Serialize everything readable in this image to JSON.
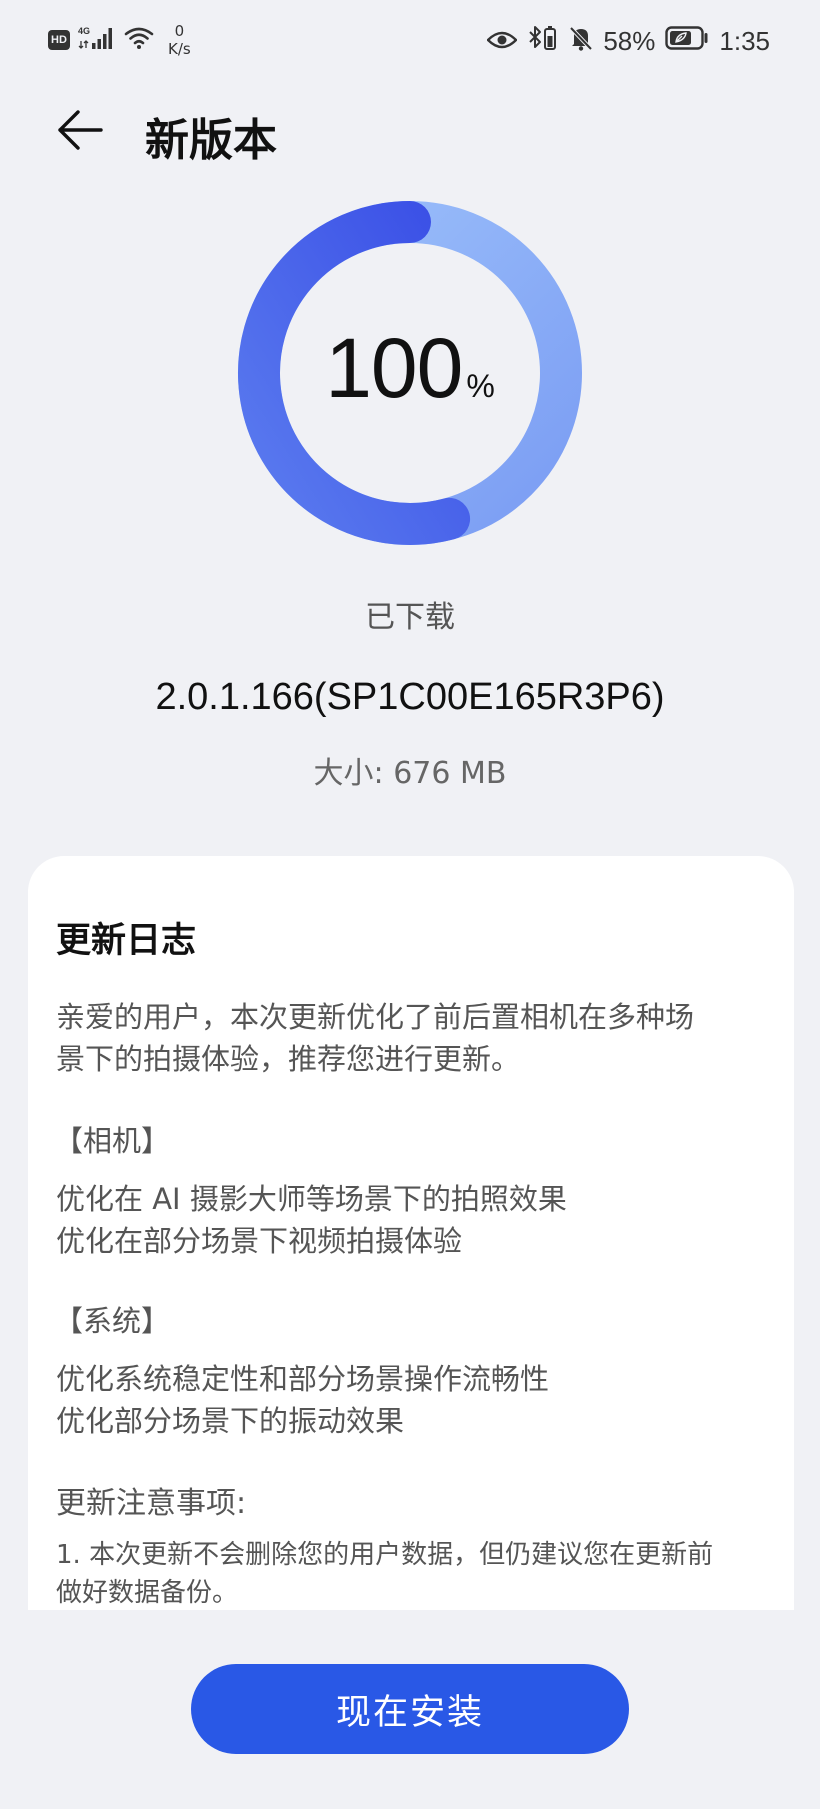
{
  "status_bar": {
    "hd_badge": "HD",
    "network": "4G",
    "speed_value": "0",
    "speed_unit": "K/s",
    "battery": "58%",
    "time": "1:35"
  },
  "header": {
    "title": "新版本"
  },
  "progress": {
    "value": "100",
    "unit": "%",
    "fraction": 1.0,
    "status": "已下载"
  },
  "package": {
    "version": "2.0.1.166(SP1C00E165R3P6)",
    "size_label": "大小:",
    "size_value": "676 MB"
  },
  "changelog": {
    "title": "更新日志",
    "intro_line1": "亲爱的用户，本次更新优化了前后置相机在多种场",
    "intro_line2": "景下的拍摄体验，推荐您进行更新。",
    "sections": [
      {
        "heading": "【相机】",
        "items": [
          "优化在 AI 摄影大师等场景下的拍照效果",
          "优化在部分场景下视频拍摄体验"
        ]
      },
      {
        "heading": "【系统】",
        "items": [
          "优化系统稳定性和部分场景操作流畅性",
          "优化部分场景下的振动效果"
        ]
      }
    ],
    "notes_title": "更新注意事项:",
    "notes_line1": "1. 本次更新不会删除您的用户数据，但仍建议您在更新前",
    "notes_line2": "做好数据备份。"
  },
  "actions": {
    "install_label": "现在安装"
  },
  "colors": {
    "accent": "#2958e6",
    "ring_start": "#3b55e8",
    "ring_end": "#9ec2fb",
    "background": "#f0f1f5"
  }
}
